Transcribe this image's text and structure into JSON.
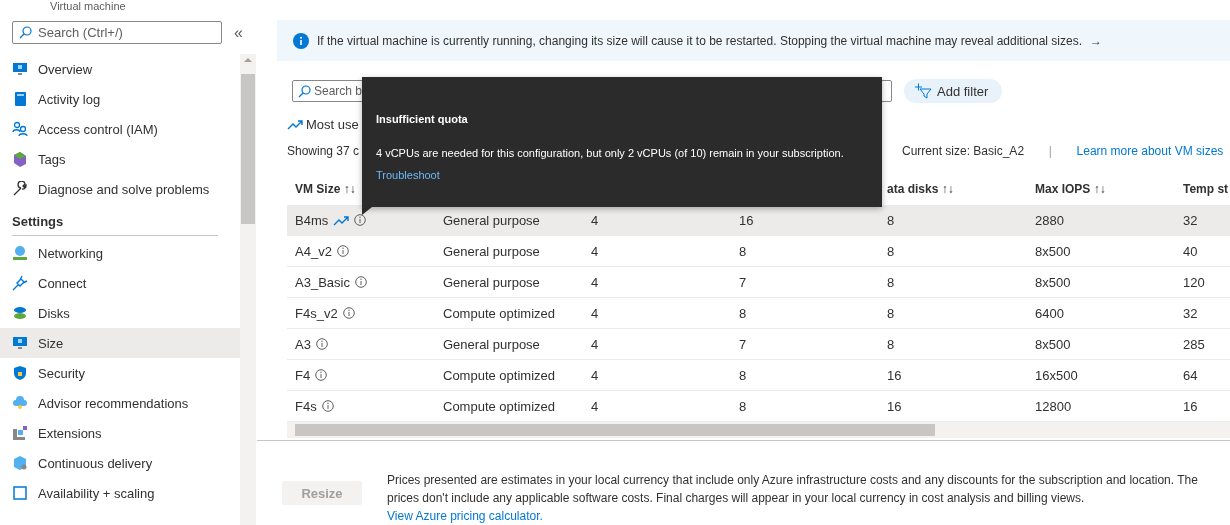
{
  "sidebar": {
    "subtitle": "Virtual machine",
    "search_placeholder": "Search (Ctrl+/)",
    "collapse": "«",
    "groups": [
      {
        "items": [
          {
            "label": "Overview",
            "selected": false
          },
          {
            "label": "Activity log",
            "selected": false
          },
          {
            "label": "Access control (IAM)",
            "selected": false
          },
          {
            "label": "Tags",
            "selected": false
          },
          {
            "label": "Diagnose and solve problems",
            "selected": false
          }
        ]
      },
      {
        "title": "Settings",
        "items": [
          {
            "label": "Networking",
            "selected": false
          },
          {
            "label": "Connect",
            "selected": false
          },
          {
            "label": "Disks",
            "selected": false
          },
          {
            "label": "Size",
            "selected": true
          },
          {
            "label": "Security",
            "selected": false
          },
          {
            "label": "Advisor recommendations",
            "selected": false
          },
          {
            "label": "Extensions",
            "selected": false
          },
          {
            "label": "Continuous delivery",
            "selected": false
          },
          {
            "label": "Availability + scaling",
            "selected": false
          }
        ]
      }
    ]
  },
  "info_banner": {
    "text": "If the virtual machine is currently running, changing its size will cause it to be restarted. Stopping the virtual machine may reveal additional sizes.",
    "arrow": "→"
  },
  "toolbar": {
    "search_placeholder": "Search b",
    "add_filter": "Add filter"
  },
  "most_used": "Most use",
  "summary": {
    "showing": "Showing 37 c",
    "current_size": "Current size: Basic_A2",
    "separator": "|",
    "learn_more": "Learn more about VM sizes"
  },
  "table": {
    "columns": [
      "VM Size ↑↓",
      null,
      null,
      null,
      "ata disks ↑↓",
      "Max IOPS ↑↓",
      "Temp st"
    ],
    "rows": [
      {
        "selected": true,
        "most_used": true,
        "cells": [
          "B4ms",
          "General purpose",
          "4",
          "16",
          "8",
          "2880",
          "32"
        ]
      },
      {
        "selected": false,
        "most_used": false,
        "cells": [
          "A4_v2",
          "General purpose",
          "4",
          "8",
          "8",
          "8x500",
          "40"
        ]
      },
      {
        "selected": false,
        "most_used": false,
        "cells": [
          "A3_Basic",
          "General purpose",
          "4",
          "7",
          "8",
          "8x500",
          "120"
        ]
      },
      {
        "selected": false,
        "most_used": false,
        "cells": [
          "F4s_v2",
          "Compute optimized",
          "4",
          "8",
          "8",
          "6400",
          "32"
        ]
      },
      {
        "selected": false,
        "most_used": false,
        "cells": [
          "A3",
          "General purpose",
          "4",
          "7",
          "8",
          "8x500",
          "285"
        ]
      },
      {
        "selected": false,
        "most_used": false,
        "cells": [
          "F4",
          "Compute optimized",
          "4",
          "8",
          "16",
          "16x500",
          "64"
        ]
      },
      {
        "selected": false,
        "most_used": false,
        "cells": [
          "F4s",
          "Compute optimized",
          "4",
          "8",
          "16",
          "12800",
          "16"
        ]
      }
    ]
  },
  "tooltip": {
    "title": "Insufficient quota",
    "message": "4 vCPUs are needed for this configuration, but only 2 vCPUs (of 10) remain in your subscription.",
    "link": "Troubleshoot"
  },
  "resize_button": {
    "label": "Resize",
    "disabled": true
  },
  "pricing_note": {
    "text": "Prices presented are estimates in your local currency that include only Azure infrastructure costs and any discounts for the subscription and location. The prices don't include any applicable software costs. Final charges will appear in your local currency in cost analysis and billing views.",
    "link": "View Azure pricing calculator."
  }
}
